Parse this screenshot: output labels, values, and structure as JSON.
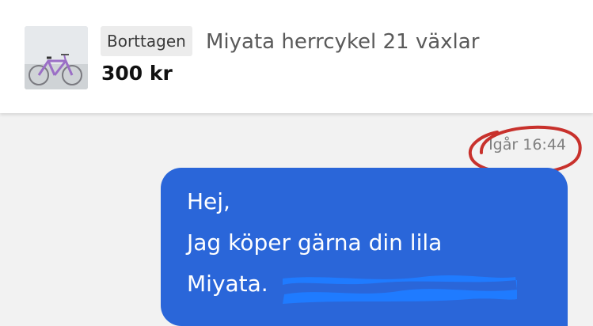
{
  "listing": {
    "status_badge": "Borttagen",
    "title": "Miyata herrcykel 21 växlar",
    "price": "300 kr",
    "thumbnail_icon": "bicycle-photo"
  },
  "message": {
    "timestamp": "Igår 16:44",
    "lines": [
      "Hej,",
      "Jag köper gärna din lila",
      "Miyata."
    ],
    "bubble_color": "#2a66d9",
    "annotation_color": "#c8312c",
    "redaction_color": "#1f7bff"
  }
}
